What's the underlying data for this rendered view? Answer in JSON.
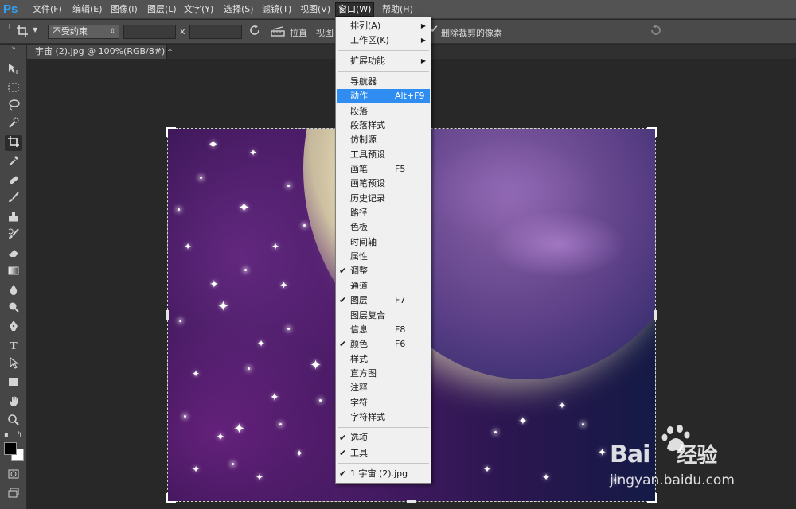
{
  "app": {
    "logo": "Ps"
  },
  "menubar": {
    "items": [
      {
        "label": "文件(F)"
      },
      {
        "label": "编辑(E)"
      },
      {
        "label": "图像(I)"
      },
      {
        "label": "图层(L)"
      },
      {
        "label": "文字(Y)"
      },
      {
        "label": "选择(S)"
      },
      {
        "label": "滤镜(T)"
      },
      {
        "label": "视图(V)"
      },
      {
        "label": "窗口(W)",
        "active": true
      },
      {
        "label": "帮助(H)"
      }
    ]
  },
  "options": {
    "tool_icon": "crop-icon",
    "ratio_value": "不受约束",
    "times_sign": "x",
    "straighten_label": "拉直",
    "view_label": "视图",
    "delete_pixels_label": "删除裁剪的像素"
  },
  "document": {
    "tab_title": "宇宙 (2).jpg @ 100%(RGB/8#) *",
    "close_glyph": "×"
  },
  "window_menu": {
    "items": [
      {
        "label": "排列(A)",
        "submenu": true
      },
      {
        "label": "工作区(K)",
        "submenu": true
      },
      {
        "label": "扩展功能",
        "submenu": true
      },
      {
        "label": "导航器"
      },
      {
        "label": "动作",
        "shortcut": "Alt+F9",
        "highlight": true
      },
      {
        "label": "段落"
      },
      {
        "label": "段落样式"
      },
      {
        "label": "仿制源"
      },
      {
        "label": "工具预设"
      },
      {
        "label": "画笔",
        "shortcut": "F5"
      },
      {
        "label": "画笔预设"
      },
      {
        "label": "历史记录"
      },
      {
        "label": "路径"
      },
      {
        "label": "色板"
      },
      {
        "label": "时间轴"
      },
      {
        "label": "属性"
      },
      {
        "label": "调整",
        "checked": true
      },
      {
        "label": "通道"
      },
      {
        "label": "图层",
        "shortcut": "F7",
        "checked": true
      },
      {
        "label": "图层复合"
      },
      {
        "label": "信息",
        "shortcut": "F8"
      },
      {
        "label": "颜色",
        "shortcut": "F6",
        "checked": true
      },
      {
        "label": "样式"
      },
      {
        "label": "直方图"
      },
      {
        "label": "注释"
      },
      {
        "label": "字符"
      },
      {
        "label": "字符样式"
      },
      {
        "label": "选项",
        "checked": true
      },
      {
        "label": "工具",
        "checked": true
      },
      {
        "label": "1 宇宙 (2).jpg",
        "checked": true
      }
    ],
    "check_glyph": "✔",
    "arrow_glyph": "▶"
  },
  "toolbox": {
    "tools": [
      "move-tool-icon",
      "marquee-tool-icon",
      "lasso-tool-icon",
      "quick-select-tool-icon",
      "crop-tool-icon",
      "eyedropper-tool-icon",
      "healing-brush-tool-icon",
      "brush-tool-icon",
      "clone-stamp-tool-icon",
      "history-brush-tool-icon",
      "eraser-tool-icon",
      "gradient-tool-icon",
      "blur-tool-icon",
      "dodge-tool-icon",
      "pen-tool-icon",
      "type-tool-icon",
      "path-select-tool-icon",
      "rectangle-tool-icon",
      "hand-tool-icon",
      "zoom-tool-icon"
    ],
    "type_glyph": "T",
    "foreground_color": "#000000",
    "background_color": "#ffffff"
  },
  "watermark": {
    "brand": "Bai",
    "brand_suffix": "经验",
    "url": "jingyan.baidu.com"
  },
  "colors": {
    "menu_highlight": "#2f8cf0",
    "ps_blue": "#2fa3f7",
    "workspace": "#282828"
  }
}
